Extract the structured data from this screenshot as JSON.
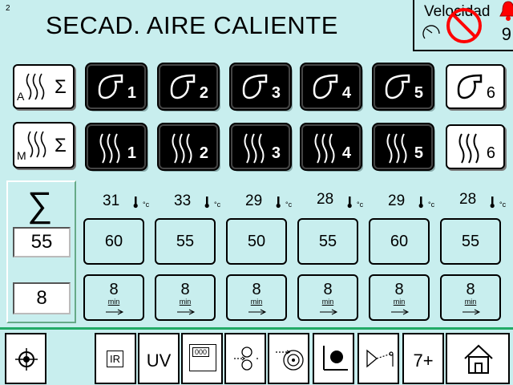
{
  "header": {
    "page_number": "2",
    "title": "SECAD. AIRE CALIENTE",
    "speed": {
      "label": "Velocidad",
      "value": "9"
    }
  },
  "fans": [
    {
      "label": "1",
      "active": true
    },
    {
      "label": "2",
      "active": true
    },
    {
      "label": "3",
      "active": true
    },
    {
      "label": "4",
      "active": true
    },
    {
      "label": "5",
      "active": true
    },
    {
      "label": "6",
      "active": false
    }
  ],
  "heaters": [
    {
      "label": "1",
      "active": true
    },
    {
      "label": "2",
      "active": true
    },
    {
      "label": "3",
      "active": true
    },
    {
      "label": "4",
      "active": true
    },
    {
      "label": "5",
      "active": true
    },
    {
      "label": "6",
      "active": false
    }
  ],
  "mode_buttons": {
    "auto_letter": "A",
    "manual_letter": "M"
  },
  "summary": {
    "sigma": "∑",
    "setpoint": "55",
    "time": "8"
  },
  "zones": [
    {
      "temp": "31",
      "setpoint": "60",
      "time": "8"
    },
    {
      "temp": "33",
      "setpoint": "55",
      "time": "8"
    },
    {
      "temp": "29",
      "setpoint": "50",
      "time": "8"
    },
    {
      "temp": "28",
      "setpoint": "55",
      "time": "8"
    },
    {
      "temp": "29",
      "setpoint": "60",
      "time": "8"
    },
    {
      "temp": "28",
      "setpoint": "55",
      "time": "8"
    }
  ],
  "units": {
    "temp": "°c",
    "time": "min"
  },
  "footer": {
    "ir": "IR",
    "uv": "UV",
    "counter": "000",
    "next_page": "7+"
  },
  "colors": {
    "background": "#c8eeee",
    "active": "#000000",
    "inactive": "#ffffff",
    "alarm": "#ff0000"
  }
}
